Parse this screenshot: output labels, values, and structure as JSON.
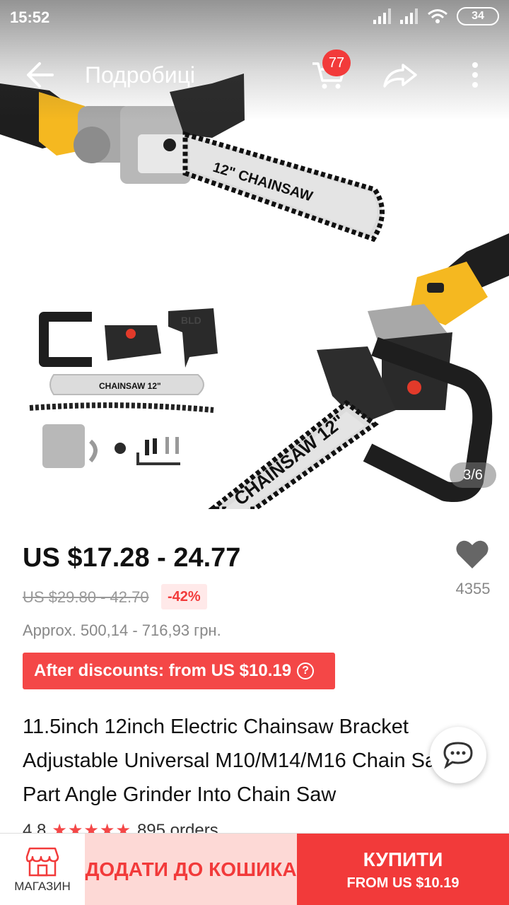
{
  "status_bar": {
    "time": "15:52",
    "battery": "34"
  },
  "nav": {
    "title": "Подробиці",
    "cart_count": "77"
  },
  "product_image": {
    "counter": "3/6",
    "blade_label_top": "12\" CHAINSAW",
    "blade_label_small": "CHAINSAW 12\"",
    "blade_label_bottom": "CHAINSAW 12\"",
    "cover_brand": "BLD"
  },
  "price": {
    "current": "US $17.28 - 24.77",
    "original": "US $29.80 - 42.70",
    "discount": "-42%",
    "approx": "Approx. 500,14 - 716,93 грн.",
    "after_discounts": "After discounts: from US $10.19"
  },
  "favorites": {
    "count": "4355"
  },
  "title": "11.5inch 12inch  Electric Chainsaw Bracket Adjustable Universal M10/M14/M16 Chain Saw Part Angle Grinder Into Chain Saw",
  "rating": {
    "score": "4.8",
    "stars": "★★★★★",
    "orders": "895 orders"
  },
  "bottom_bar": {
    "store_label": "МАГАЗИН",
    "add_to_cart": "ДОДАТИ ДО КОШИКА",
    "buy": "КУПИТИ",
    "buy_sub": "FROM US $10.19"
  },
  "colors": {
    "accent": "#f23a3a",
    "yellow": "#f5b820"
  }
}
